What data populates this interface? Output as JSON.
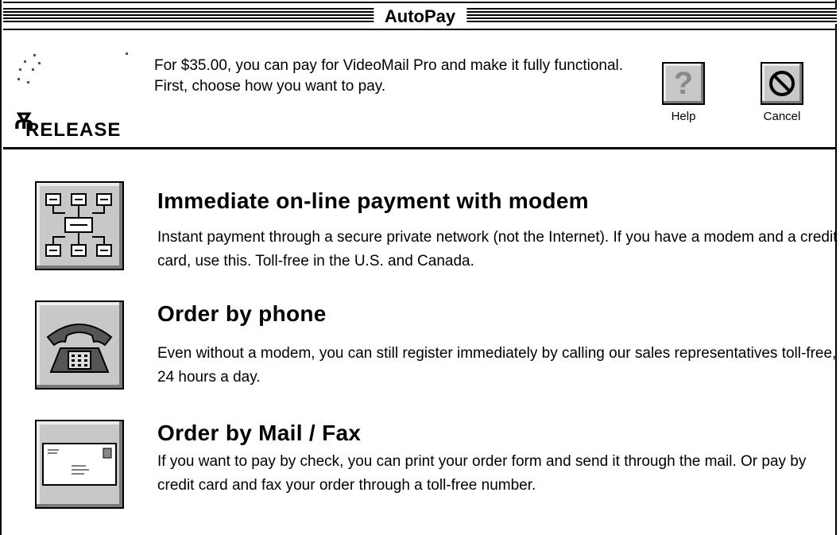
{
  "window": {
    "title": "AutoPay"
  },
  "header": {
    "logo_text": "RELEASE",
    "intro": "For $35.00, you can pay for VideoMail Pro and make it fully functional. First, choose how you want to pay.",
    "help_label": "Help",
    "cancel_label": "Cancel"
  },
  "options": [
    {
      "title": "Immediate on-line payment with modem",
      "description": "Instant payment through a secure private network (not the Internet). If you have a modem and a credit card, use this. Toll-free in the U.S. and Canada.",
      "icon": "network-icon"
    },
    {
      "title": "Order by phone",
      "description": "Even without a modem, you can still register immediately by calling our sales representatives toll-free, 24 hours a day.",
      "icon": "telephone-icon"
    },
    {
      "title": "Order by Mail / Fax",
      "description": "If you want to pay by check, you can print your order form and send it through the mail. Or pay by credit card and fax your order through a toll-free number.",
      "icon": "envelope-icon"
    }
  ]
}
